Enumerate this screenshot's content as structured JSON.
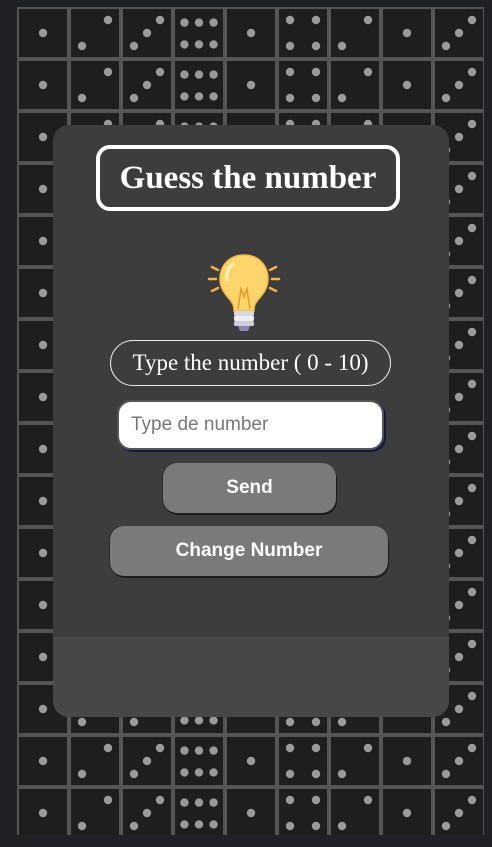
{
  "page": {
    "title": "Guess the number",
    "hint": "Type the number ( 0 - 10)",
    "input_placeholder": "Type de number",
    "input_value": "",
    "send_label": "Send",
    "change_label": "Change Number"
  },
  "icons": {
    "hint": "lightbulb-icon",
    "background": "domino-tiles"
  },
  "colors": {
    "page_background": "#202124",
    "tile_background": "#1c1c1c",
    "card_background": "#3d3d3d",
    "button_background": "#7a7a7a",
    "bulb_yellow": "#fdd56a"
  }
}
